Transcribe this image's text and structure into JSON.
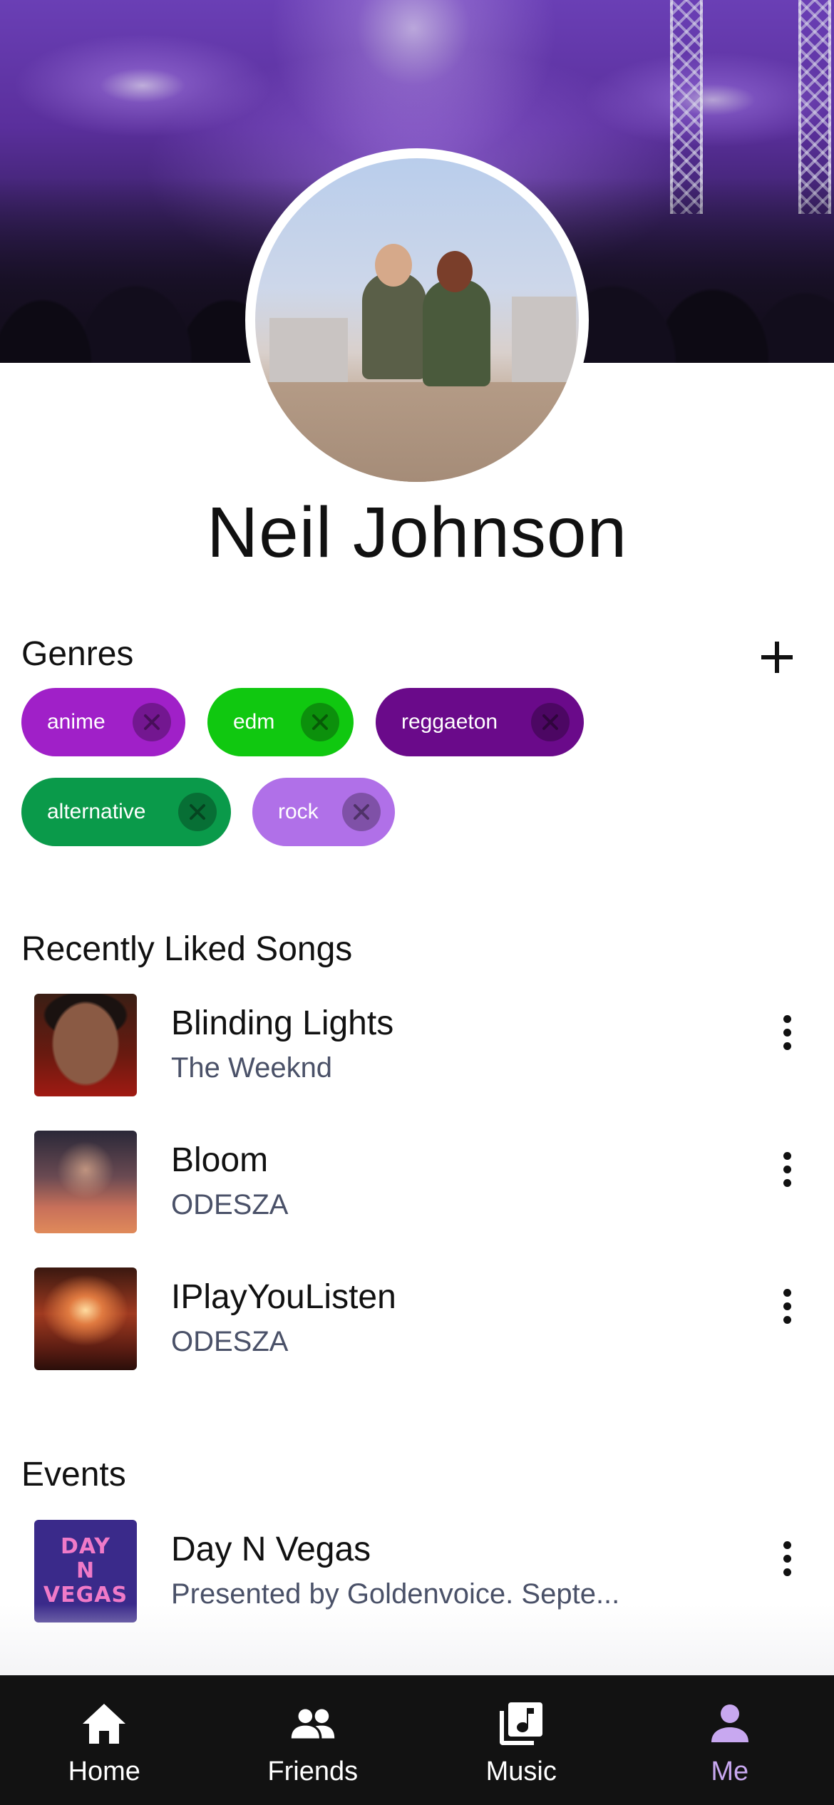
{
  "profile": {
    "name": "Neil Johnson"
  },
  "genres": {
    "title": "Genres",
    "add_icon": "plus-icon",
    "items": [
      {
        "label": "anime",
        "color": "#a020c8"
      },
      {
        "label": "edm",
        "color": "#10c810"
      },
      {
        "label": "reggaeton",
        "color": "#6a0a8a"
      },
      {
        "label": "alternative",
        "color": "#0a9a4a"
      },
      {
        "label": "rock",
        "color": "#b070e8"
      }
    ]
  },
  "liked_songs": {
    "title": "Recently Liked Songs",
    "items": [
      {
        "title": "Blinding Lights",
        "artist": "The Weeknd"
      },
      {
        "title": "Bloom",
        "artist": "ODESZA"
      },
      {
        "title": "IPlayYouListen",
        "artist": "ODESZA"
      }
    ]
  },
  "events": {
    "title": "Events",
    "items": [
      {
        "title": "Day N Vegas",
        "subtitle": "Presented by Goldenvoice. Septe...",
        "art_text": [
          "DAY",
          "N",
          "VEGAS"
        ]
      }
    ]
  },
  "nav": {
    "items": [
      {
        "label": "Home",
        "icon": "home-icon",
        "active": false
      },
      {
        "label": "Friends",
        "icon": "friends-icon",
        "active": false
      },
      {
        "label": "Music",
        "icon": "music-library-icon",
        "active": false
      },
      {
        "label": "Me",
        "icon": "person-icon",
        "active": true
      }
    ],
    "active_color": "#c8a8f0"
  }
}
